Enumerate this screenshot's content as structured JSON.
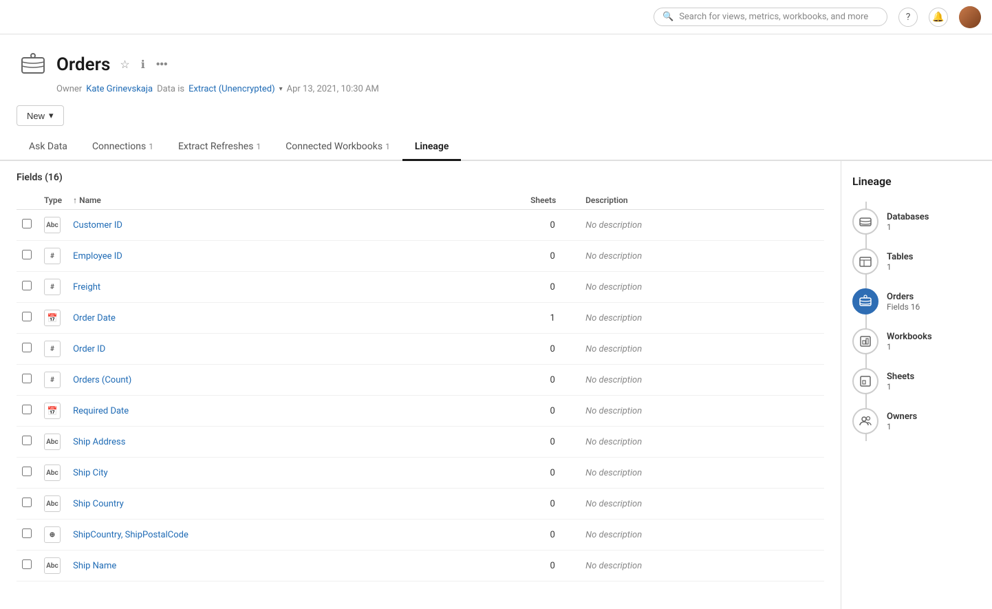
{
  "topnav": {
    "search_placeholder": "Search for views, metrics, workbooks, and more"
  },
  "header": {
    "title": "Orders",
    "owner_label": "Owner",
    "owner_name": "Kate Grinevskaja",
    "data_label": "Data is",
    "data_type": "Extract (Unencrypted)",
    "data_date": "Apr 13, 2021, 10:30 AM"
  },
  "new_button": "New",
  "tabs": [
    {
      "label": "Ask Data",
      "count": "",
      "active": false
    },
    {
      "label": "Connections",
      "count": "1",
      "active": false
    },
    {
      "label": "Extract Refreshes",
      "count": "1",
      "active": false
    },
    {
      "label": "Connected Workbooks",
      "count": "1",
      "active": false
    },
    {
      "label": "Lineage",
      "count": "",
      "active": true
    }
  ],
  "fields": {
    "title": "Fields (16)",
    "columns": {
      "type": "Type",
      "name": "↑ Name",
      "sheets": "Sheets",
      "description": "Description"
    },
    "rows": [
      {
        "type": "Abc",
        "name": "Customer ID",
        "sheets": 0,
        "description": "No description"
      },
      {
        "type": "#",
        "name": "Employee ID",
        "sheets": 0,
        "description": "No description"
      },
      {
        "type": "#",
        "name": "Freight",
        "sheets": 0,
        "description": "No description"
      },
      {
        "type": "cal",
        "name": "Order Date",
        "sheets": 1,
        "description": "No description"
      },
      {
        "type": "#",
        "name": "Order ID",
        "sheets": 0,
        "description": "No description"
      },
      {
        "type": "#",
        "name": "Orders (Count)",
        "sheets": 0,
        "description": "No description"
      },
      {
        "type": "cal",
        "name": "Required Date",
        "sheets": 0,
        "description": "No description"
      },
      {
        "type": "Abc",
        "name": "Ship Address",
        "sheets": 0,
        "description": "No description"
      },
      {
        "type": "Abc",
        "name": "Ship City",
        "sheets": 0,
        "description": "No description"
      },
      {
        "type": "Abc",
        "name": "Ship Country",
        "sheets": 0,
        "description": "No description"
      },
      {
        "type": "geo",
        "name": "ShipCountry, ShipPostalCode",
        "sheets": 0,
        "description": "No description"
      },
      {
        "type": "Abc",
        "name": "Ship Name",
        "sheets": 0,
        "description": "No description"
      }
    ]
  },
  "lineage": {
    "title": "Lineage",
    "items": [
      {
        "label": "Databases",
        "count": "1",
        "icon": "db",
        "active": false
      },
      {
        "label": "Tables",
        "count": "1",
        "icon": "table",
        "active": false
      },
      {
        "label": "Orders",
        "count": "Fields 16",
        "icon": "ds",
        "active": true
      },
      {
        "label": "Workbooks",
        "count": "1",
        "icon": "wb",
        "active": false
      },
      {
        "label": "Sheets",
        "count": "1",
        "icon": "sheet",
        "active": false
      },
      {
        "label": "Owners",
        "count": "1",
        "icon": "people",
        "active": false
      }
    ]
  }
}
